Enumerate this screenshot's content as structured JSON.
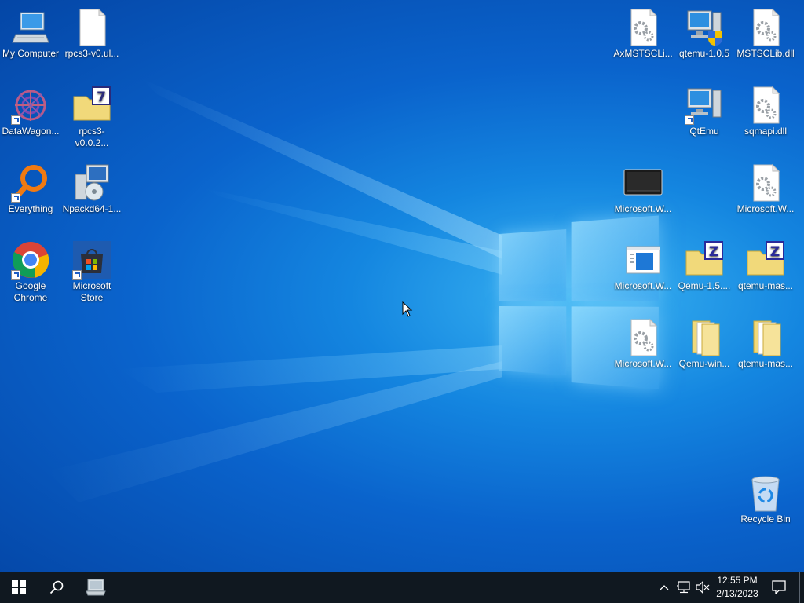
{
  "desktop": {
    "icons": [
      {
        "id": "my-computer",
        "label": "My Computer",
        "icon": "computer-icon",
        "shortcut": false
      },
      {
        "id": "rpcs3-ui",
        "label": "rpcs3-v0.ul...",
        "icon": "blank-file-icon",
        "shortcut": false
      },
      {
        "id": "datawagon",
        "label": "DataWagon...",
        "icon": "datawagon-icon",
        "shortcut": true
      },
      {
        "id": "rpcs3-7z",
        "label": "rpcs3-v0.0.2...",
        "icon": "7z-archive-icon",
        "shortcut": false
      },
      {
        "id": "everything",
        "label": "Everything",
        "icon": "magnifier-icon",
        "shortcut": true
      },
      {
        "id": "npackd",
        "label": "Npackd64-1...",
        "icon": "installer-icon",
        "shortcut": false
      },
      {
        "id": "google-chrome",
        "label": "Google Chrome",
        "icon": "chrome-icon",
        "shortcut": true
      },
      {
        "id": "microsoft-store",
        "label": "Microsoft Store",
        "icon": "store-icon",
        "shortcut": true
      },
      {
        "id": "axmstsclib",
        "label": "AxMSTSCLi...",
        "icon": "dll-file-icon",
        "shortcut": false
      },
      {
        "id": "qtemu-105",
        "label": "qtemu-1.0.5",
        "icon": "qtemu-installer-icon",
        "shortcut": false
      },
      {
        "id": "mstsclib",
        "label": "MSTSCLib.dll",
        "icon": "dll-file-icon",
        "shortcut": false
      },
      {
        "id": "qtemu",
        "label": "QtEmu",
        "icon": "qtemu-icon",
        "shortcut": true
      },
      {
        "id": "sqmapi",
        "label": "sqmapi.dll",
        "icon": "dll-file-icon",
        "shortcut": false
      },
      {
        "id": "ms-w-monitor",
        "label": "Microsoft.W...",
        "icon": "monitor-icon",
        "shortcut": false
      },
      {
        "id": "ms-w-dll1",
        "label": "Microsoft.W...",
        "icon": "dll-file-icon",
        "shortcut": false
      },
      {
        "id": "ms-w-app",
        "label": "Microsoft.W...",
        "icon": "app-window-icon",
        "shortcut": false
      },
      {
        "id": "qemu-15",
        "label": "Qemu-1.5....",
        "icon": "zip-archive-icon",
        "shortcut": false
      },
      {
        "id": "qtemu-mas-zip",
        "label": "qtemu-mas...",
        "icon": "zip-archive-icon",
        "shortcut": false
      },
      {
        "id": "ms-w-dll2",
        "label": "Microsoft.W...",
        "icon": "dll-file-icon",
        "shortcut": false
      },
      {
        "id": "qemu-win",
        "label": "Qemu-win...",
        "icon": "folder-icon",
        "shortcut": false
      },
      {
        "id": "qtemu-mas-folder",
        "label": "qtemu-mas...",
        "icon": "folder-icon",
        "shortcut": false
      },
      {
        "id": "recycle-bin",
        "label": "Recycle Bin",
        "icon": "recycle-bin-icon",
        "shortcut": false
      }
    ]
  },
  "taskbar": {
    "start": "windows-start-icon",
    "search": "search-icon",
    "pinned": "computer-icon",
    "tray": {
      "chevron": "chevron-up-icon",
      "network": "network-icon",
      "volume": "volume-muted-icon",
      "notifications": "notification-icon"
    },
    "clock": {
      "time": "12:55 PM",
      "date": "2/13/2023"
    }
  },
  "colors": {
    "taskbar": "#101820",
    "desktop_accent": "#0a63cc"
  }
}
